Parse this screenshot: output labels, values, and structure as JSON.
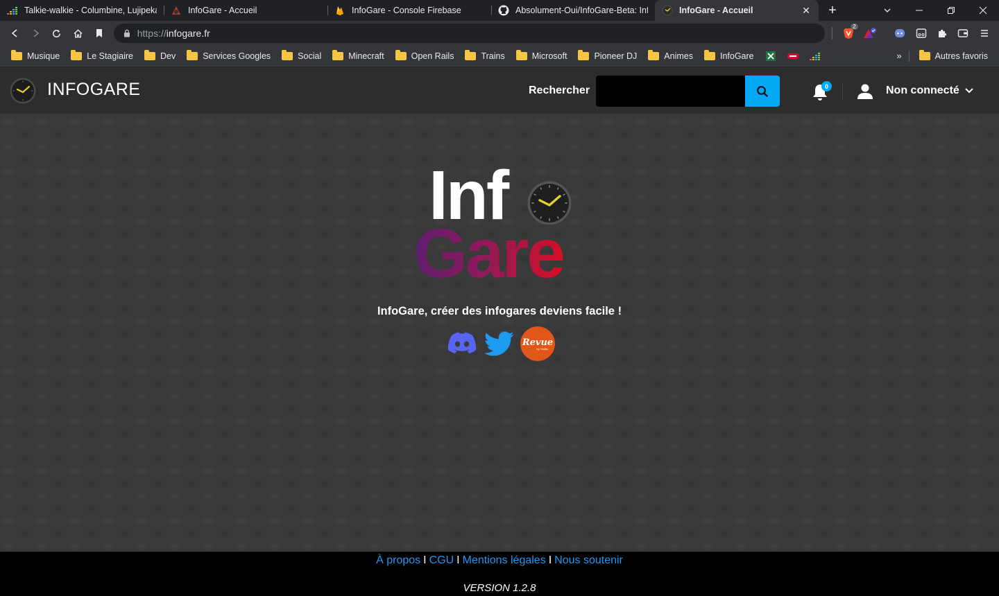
{
  "browser": {
    "tabs": [
      {
        "title": "Talkie-walkie - Columbine, Lujipeka, F",
        "favicon": "deezer-icon",
        "active": false
      },
      {
        "title": "InfoGare - Accueil",
        "favicon": "infogare-icon",
        "active": false
      },
      {
        "title": "InfoGare - Console Firebase",
        "favicon": "firebase-icon",
        "active": false
      },
      {
        "title": "Absolument-Oui/InfoGare-Beta: InfoG",
        "favicon": "github-icon",
        "active": false
      },
      {
        "title": "InfoGare - Accueil",
        "favicon": "clock-icon",
        "active": true
      }
    ],
    "url_scheme": "https://",
    "url_host": "infogare.fr",
    "bookmarks": [
      "Musique",
      "Le Stagiaire",
      "Dev",
      "Services Googles",
      "Social",
      "Minecraft",
      "Open Rails",
      "Trains",
      "Microsoft",
      "Pioneer DJ",
      "Animes",
      "InfoGare"
    ],
    "other_bookmarks": "Autres favoris",
    "brave_badge": "2"
  },
  "site": {
    "brand": "INFOGARE",
    "search_label": "Rechercher",
    "search_value": "",
    "notifications_count": "0",
    "user_label": "Non connecté",
    "logo_top": "Inf",
    "logo_bottom": "Gare",
    "tagline": "InfoGare, créer des infogares deviens facile !",
    "socials": [
      "discord-icon",
      "twitter-icon",
      "revue-icon"
    ],
    "revue_text": "Revue",
    "revue_sub": "by Twitter",
    "colors": {
      "header_bg": "#2d2d2d",
      "accent": "#03a9f4",
      "link": "#2196f3",
      "gare_gradient_start": "#5e1d6e",
      "gare_gradient_end": "#d50f25",
      "discord": "#5865f2",
      "twitter": "#1d9bf0",
      "revue": "#e15718",
      "clock_hands": "#e4d12a"
    }
  },
  "footer": {
    "links": [
      "À propos",
      "CGU",
      "Mentions légales",
      "Nous soutenir"
    ],
    "separator": "I",
    "version": "VERSION 1.2.8"
  }
}
